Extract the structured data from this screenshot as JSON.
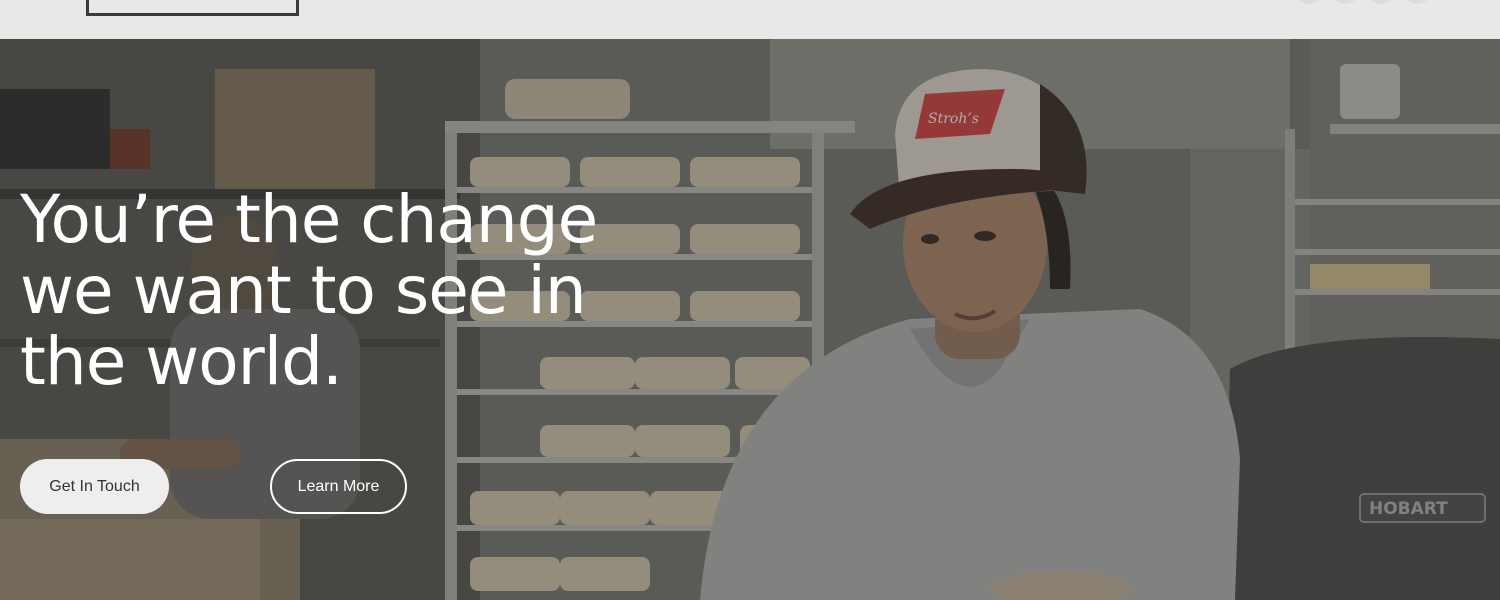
{
  "header": {
    "logo_icon": "logo-outline-box",
    "social_icons": [
      "social-icon-1",
      "social-icon-2",
      "social-icon-3",
      "social-icon-4"
    ]
  },
  "hero": {
    "headline": "You’re the change we want to see in the world.",
    "primary_cta": "Get In Touch",
    "secondary_cta": "Learn More",
    "cap_patch_text": "Stroh’s",
    "mixer_brand": "HOBART"
  },
  "colors": {
    "topbar": "#e8e8e8",
    "overlay": "rgba(40,40,38,0.38)",
    "button_primary_bg": "#eeeeee",
    "button_secondary_border": "#ffffff"
  }
}
